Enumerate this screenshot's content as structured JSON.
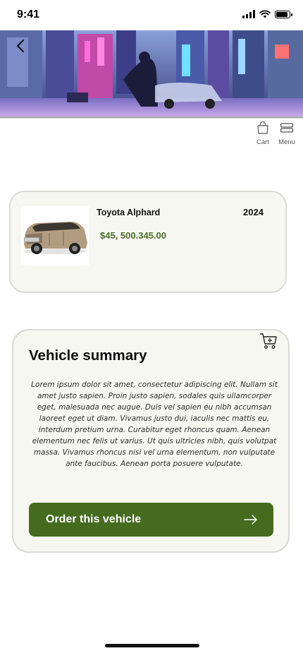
{
  "status_bar": {
    "time": "9:41"
  },
  "header": {
    "back_icon": "chevron-left-icon",
    "cart_label": "Cart",
    "menu_label": "Menu"
  },
  "product": {
    "name": "Toyota Alphard",
    "year": "2024",
    "price": "$45, 500.345.00"
  },
  "summary": {
    "title": "Vehicle summary",
    "body": "Lorem ipsum dolor sit amet, consectetur adipiscing elit. Nullam sit amet justo sapien. Proin justo sapien, sodales quis ullamcorper eget, malesuada nec augue. Duis vel sapien eu nibh accumsan laoreet eget ut diam. Vivamus justo dui, iaculis nec mattis eu, interdum pretium urna. Curabitur eget rhoncus quam. Aenean elementum nec felis ut varius. Ut quis ultricies nibh, quis volutpat massa. Vivamus rhoncus nisi vel urna elementum, non vulputate ante faucibus. Aenean porta posuere vulputate.",
    "order_button": "Order this vehicle"
  },
  "colors": {
    "accent_green": "#456b1f",
    "price_green": "#4a6f2a",
    "card_bg": "#f7f7f1",
    "card_border": "#dadad6"
  }
}
